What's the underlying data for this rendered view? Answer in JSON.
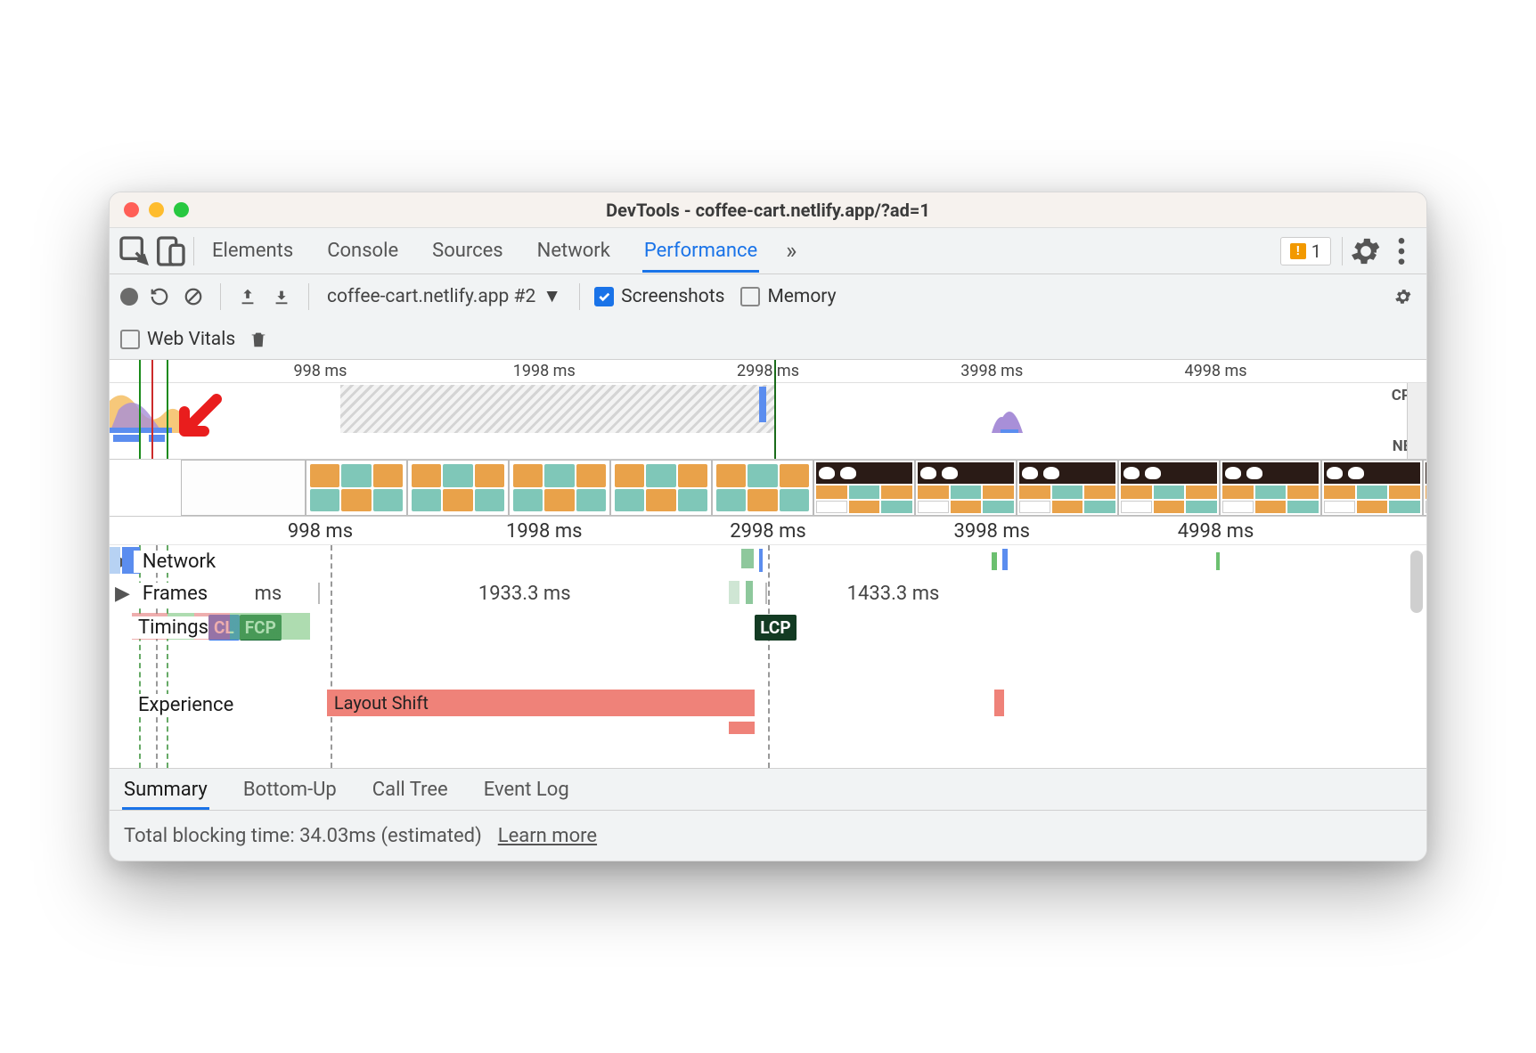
{
  "window": {
    "title": "DevTools - coffee-cart.netlify.app/?ad=1"
  },
  "tabs": {
    "items": [
      "Elements",
      "Console",
      "Sources",
      "Network",
      "Performance"
    ],
    "active": "Performance",
    "overflow_glyph": "»",
    "issues_count": "1"
  },
  "toolbar": {
    "recording_name": "coffee-cart.netlify.app #2",
    "screenshots_label": "Screenshots",
    "screenshots_checked": true,
    "memory_label": "Memory",
    "memory_checked": false
  },
  "toolbar2": {
    "web_vitals_label": "Web Vitals",
    "web_vitals_checked": false
  },
  "overview": {
    "ticks": [
      "998 ms",
      "1998 ms",
      "2998 ms",
      "3998 ms",
      "4998 ms"
    ],
    "tick_positions_pct": [
      16,
      33,
      50,
      67,
      84
    ],
    "cpu_label": "CPU",
    "net_label": "NET",
    "hatch_start_pct": 17.5,
    "hatch_end_pct": 50.5
  },
  "main_ruler": {
    "ticks": [
      "998 ms",
      "1998 ms",
      "2998 ms",
      "3998 ms",
      "4998 ms"
    ],
    "tick_positions_pct": [
      16,
      33,
      50,
      67,
      84
    ]
  },
  "tracks": {
    "network_label": "Network",
    "frames_label": "Frames",
    "frames_values": {
      "a": "ms",
      "b": "1933.3 ms",
      "c": "1433.3 ms"
    },
    "timings_label": "Timings",
    "timings": {
      "cl": "CL",
      "fcp": "FCP",
      "lcp": "LCP",
      "lcp_pos_pct": 49
    },
    "experience_label": "Experience",
    "experience_event": "Layout Shift",
    "experience_bar": {
      "start_pct": 16.5,
      "end_pct": 49
    }
  },
  "detail_tabs": {
    "items": [
      "Summary",
      "Bottom-Up",
      "Call Tree",
      "Event Log"
    ],
    "active": "Summary"
  },
  "summary": {
    "tbt_text": "Total blocking time: 34.03ms (estimated)",
    "learn_more": "Learn more"
  },
  "colors": {
    "accent": "#1a73e8",
    "warn": "#f29900",
    "ls": "#ef8279",
    "green": "#1c6b39"
  }
}
